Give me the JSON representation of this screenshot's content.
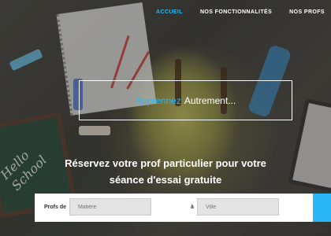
{
  "nav": {
    "items": [
      {
        "label": "ACCUEIL",
        "active": true
      },
      {
        "label": "NOS FONCTIONNALITÉS",
        "active": false
      },
      {
        "label": "NOS PROFS",
        "active": false
      }
    ]
  },
  "hero": {
    "tagline_accent": "Apprennez",
    "tagline_rest": "Autrement...",
    "headline_line1": "Réservez votre prof particulier pour votre",
    "headline_line2": "séance d'essai gratuite",
    "chalkboard_text": "Hello School"
  },
  "search": {
    "subject_label": "Profs de",
    "subject_placeholder": "Matière",
    "city_label": "à",
    "city_placeholder": "Ville",
    "button_icon": "search-icon"
  },
  "colors": {
    "accent": "#29b6f6",
    "text_light": "#ffffff"
  }
}
